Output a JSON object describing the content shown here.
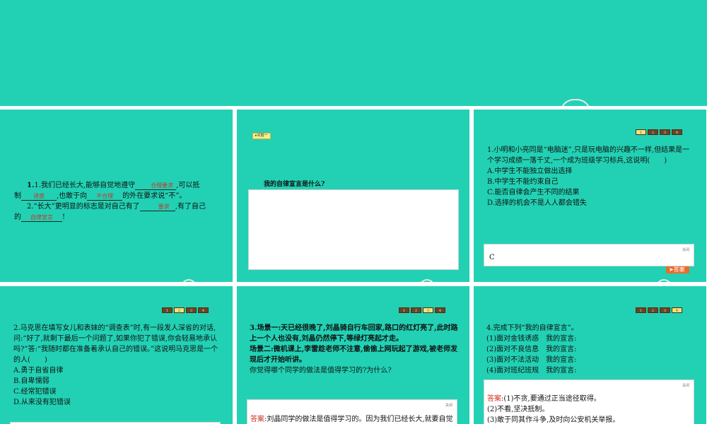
{
  "p1": {
    "q1_pre": "1.我们已经长大,能够自觉地遵守",
    "q1_fill1": "合理要求",
    "q1_mid1": ",可以抵",
    "q1_pre2": "制",
    "q1_fill2": "诱惑",
    "q1_mid2": ",也敢于向",
    "q1_fill3": "不合理",
    "q1_end": "的外在要求说“不”。",
    "q2_pre": "2.“长大”更明显的标志是对自己有了",
    "q2_fill1": "要求",
    "q2_mid": ",有了自己",
    "q2_pre2": "的",
    "q2_fill2": "自律宣言",
    "q2_end": "!"
  },
  "p2": {
    "tag": "问题一",
    "question": "我的自律宣言是什么?"
  },
  "p3": {
    "nav": [
      "1",
      "2",
      "3",
      "4"
    ],
    "question": "1.小明和小亮同是“电脑迷”,只是玩电脑的兴趣不一样,但结果是一个学习成绩一落千丈,一个成为班级学习标兵,这说明(　　)",
    "options": [
      "A.中学生不能独立做出选择",
      "B.中学生不能约束自己",
      "C.能否自律会产生不同的结果",
      "D.选择的机会不是人人都会错失"
    ],
    "close": "关闭",
    "answer": "C",
    "answer_button": "答案"
  },
  "p4": {
    "nav": [
      "1",
      "2",
      "3",
      "4"
    ],
    "question": "2.马克思在填写女儿和表妹的“调查表”时,有一段发人深省的对话,问:“好了,就剩下最后一个问题了,如果你犯了错误,你会轻易地承认吗?”答:“我随时都在准备着承认自己的错误。”这说明马克思是一个的人(　　)",
    "options": [
      "A.勇于自省自律",
      "B.自卑懦弱",
      "C.经常犯错误",
      "D.从来没有犯错误"
    ]
  },
  "p5": {
    "nav": [
      "1",
      "2",
      "3",
      "4"
    ],
    "scene1": "3.场景一:天已经很晚了,刘晶骑自行车回家,路口的红灯亮了,此时路上一个人也没有,刘晶仍然停下,等绿灯亮起才走。",
    "scene2": "场景二:微机课上,李雷趁老师不注意,偷偷上网玩起了游戏,被老师发现后才开始听讲。",
    "question": "你觉得哪个同学的做法是值得学习的?为什么?",
    "close": "关闭",
    "answer_label": "答案",
    "answer": ":刘晶同学的做法是值得学习的。因为我们已经长大,就要自觉"
  },
  "p6": {
    "nav": [
      "1",
      "2",
      "3",
      "4"
    ],
    "title": "4.完成下列“我的自律宣言”。",
    "items": [
      "(1)面对金钱诱惑　我的宣言:",
      "(2)面对不良信息　我的宣言:",
      "(3)面对不法活动　我的宣言:",
      "(4)面对班纪班规　我的宣言:"
    ],
    "close": "关闭",
    "answer_label": "答案",
    "answer_lines": [
      ":(1)不贪,要通过正当途径取得。",
      "(2)不看,坚决抵制。",
      "(3)敢于同其作斗争,及时向公安机关举报。"
    ]
  },
  "colors": {
    "slide_bg": "#22d1b4",
    "nav_active": "#f5e27a",
    "nav_inactive": "#6b4423",
    "answer_label": "#d0301e",
    "answer_button": "#ee6a2c"
  }
}
